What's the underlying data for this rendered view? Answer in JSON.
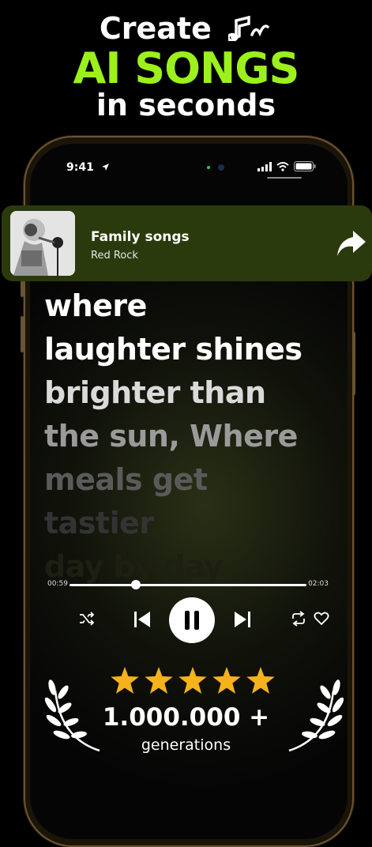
{
  "headline": {
    "line1": "Create",
    "line2": "AI SONGS",
    "line3": "in seconds"
  },
  "status_bar": {
    "time": "9:41"
  },
  "now_playing": {
    "title": "Family songs",
    "artist": "Red Rock"
  },
  "lyrics": [
    "where",
    "laughter shines",
    "brighter than",
    "the sun, Where",
    "meals get",
    "tastier",
    "day by day"
  ],
  "player": {
    "current_time": "00:59",
    "total_time": "02:03",
    "progress": 0.28
  },
  "rating": {
    "stars": 5,
    "count": "1.000.000 +",
    "label": "generations"
  },
  "colors": {
    "accent": "#9cf01b",
    "card_bg": "#2b3a0d",
    "star": "#f6b21b"
  }
}
